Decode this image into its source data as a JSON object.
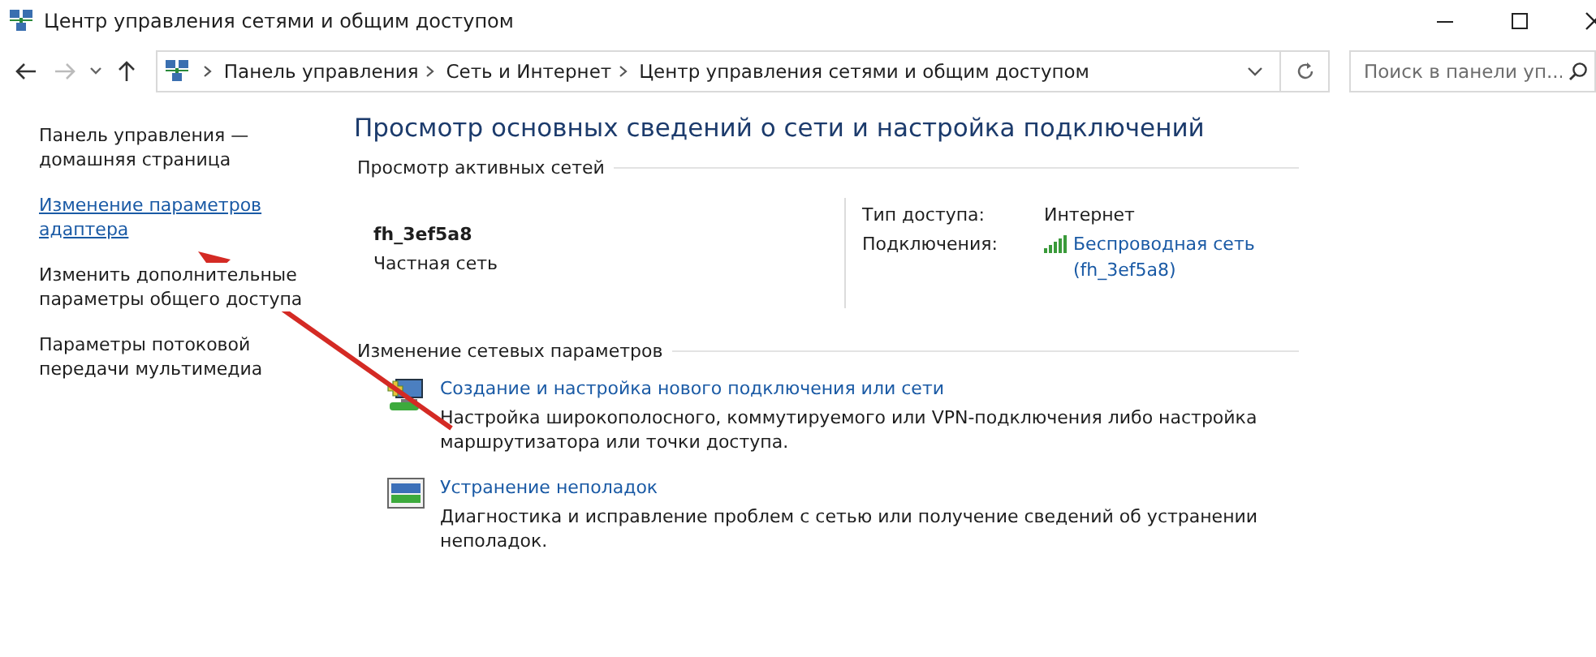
{
  "window": {
    "title": "Центр управления сетями и общим доступом"
  },
  "address_bar": {
    "breadcrumbs": [
      "Панель управления",
      "Сеть и Интернет",
      "Центр управления сетями и общим доступом"
    ]
  },
  "search": {
    "placeholder": "Поиск в панели уп..."
  },
  "sidebar": {
    "items": [
      {
        "text": "Панель управления —\nдомашняя страница",
        "kind": "plain"
      },
      {
        "text": "Изменение параметров\nадаптера",
        "kind": "link"
      },
      {
        "text": "Изменить дополнительные\nпараметры общего доступа",
        "kind": "plain"
      },
      {
        "text": "Параметры потоковой\nпередачи мультимедиа",
        "kind": "plain"
      }
    ]
  },
  "heading": "Просмотр основных сведений о сети и настройка подключений",
  "active_networks": {
    "title": "Просмотр активных сетей",
    "name": "fh_3ef5a8",
    "category": "Частная сеть",
    "properties": [
      {
        "label": "Тип доступа:",
        "value": "Интернет",
        "kind": "text"
      },
      {
        "label": "Подключения:",
        "value": "Беспроводная сеть\n(fh_3ef5a8)",
        "kind": "wifi-link"
      }
    ]
  },
  "change_settings": {
    "title": "Изменение сетевых параметров",
    "tasks": [
      {
        "kind": "new-connection",
        "link": "Создание и настройка нового подключения или сети",
        "description": "Настройка широкополосного, коммутируемого или VPN-подключения либо настройка\nмаршрутизатора или точки доступа."
      },
      {
        "kind": "troubleshoot",
        "link": "Устранение неполадок",
        "description": "Диагностика и исправление проблем с сетью или получение сведений об устранении\nнеполадок."
      }
    ]
  }
}
